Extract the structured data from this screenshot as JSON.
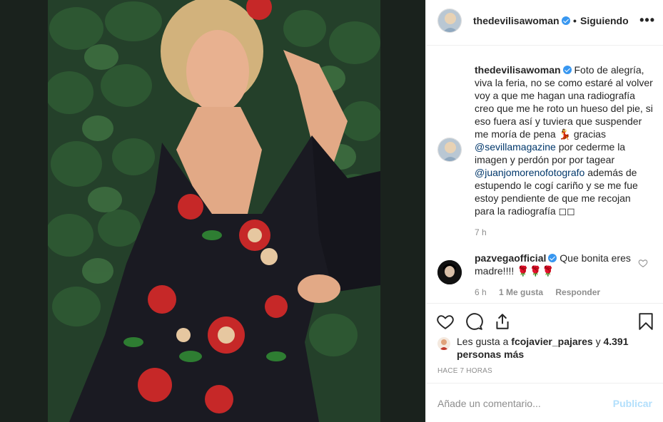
{
  "header": {
    "username": "thedevilisawoman",
    "separator": "•",
    "follow_label": "Siguiendo",
    "more_label": "•••"
  },
  "caption": {
    "username": "thedevilisawoman",
    "text_1": "Foto de alegría, viva la feria, no se como estaré al volver voy a que me hagan una radiografía creo que me he roto un hueso del pie, si eso fuera así y tuviera que suspender me moría de pena 💃 gracias ",
    "mention_1": "@sevillamagazine",
    "text_2": " por cederme la imagen y perdón por por tagear ",
    "mention_2": "@juanjomorenofotografo",
    "text_3": " además de estupendo le cogí cariño y se me fue estoy pendiente de que me recojan para la radiografía ◻◻",
    "time": "7 h"
  },
  "comment": {
    "username": "pazvegaofficial",
    "text": " Que bonita eres madre!!!! 🌹🌹🌹",
    "time": "6 h",
    "likes": "1 Me gusta",
    "reply_label": "Responder"
  },
  "likes": {
    "prefix": "Les gusta a ",
    "user": "fcojavier_pajares",
    "middle": " y ",
    "count": "4.391 personas más"
  },
  "posted_ago": "HACE 7 HORAS",
  "add_comment": {
    "placeholder": "Añade un comentario...",
    "publish_label": "Publicar"
  },
  "colors": {
    "link": "#00376b",
    "verified": "#3897f0",
    "publish_disabled": "#b2dffc",
    "muted": "#8e8e8e"
  },
  "icons": [
    "heart-icon",
    "comment-icon",
    "share-icon",
    "bookmark-icon",
    "verified-badge-icon",
    "more-options-icon"
  ]
}
